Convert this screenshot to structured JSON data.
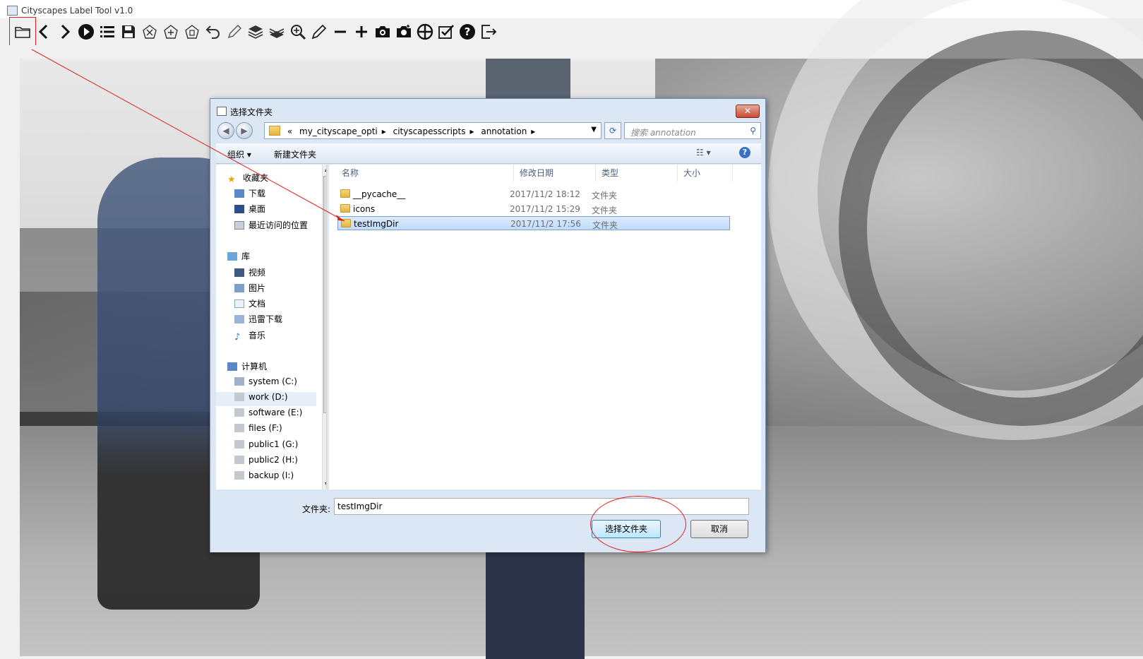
{
  "window": {
    "title": "Cityscapes Label Tool v1.0"
  },
  "toolbar": {
    "icons": [
      "open-folder-icon",
      "previous-icon",
      "next-icon",
      "play-icon",
      "list-icon",
      "save-icon",
      "clear-polygon-icon",
      "new-polygon-icon",
      "delete-polygon-icon",
      "undo-icon",
      "edit-icon",
      "layer-up-icon",
      "layer-down-icon",
      "zoom-icon",
      "pencil-icon",
      "minus-icon",
      "plus-icon",
      "screenshot-icon",
      "screenshot-toggle-icon",
      "crosshair-icon",
      "check-icon",
      "help-icon",
      "exit-icon"
    ]
  },
  "dialog": {
    "title": "选择文件夹",
    "close": "✕",
    "address": {
      "prefix": "«",
      "crumbs": [
        "my_cityscape_opti",
        "cityscapesscripts",
        "annotation"
      ]
    },
    "search_placeholder": "搜索 annotation",
    "commands": {
      "organize": "组织 ▾",
      "new_folder": "新建文件夹"
    },
    "help": "?",
    "nav": {
      "favorites": {
        "label": "收藏夹",
        "items": [
          "下载",
          "桌面",
          "最近访问的位置"
        ]
      },
      "libraries": {
        "label": "库",
        "items": [
          "视频",
          "图片",
          "文档",
          "迅雷下载",
          "音乐"
        ]
      },
      "computer": {
        "label": "计算机",
        "items": [
          "system (C:)",
          "work (D:)",
          "software (E:)",
          "files (F:)",
          "public1 (G:)",
          "public2 (H:)",
          "backup (I:)"
        ]
      }
    },
    "columns": {
      "name": "名称",
      "date": "修改日期",
      "type": "类型",
      "size": "大小"
    },
    "files": [
      {
        "name": "__pycache__",
        "date": "2017/11/2 18:12",
        "type": "文件夹"
      },
      {
        "name": "icons",
        "date": "2017/11/2 15:29",
        "type": "文件夹"
      },
      {
        "name": "testImgDir",
        "date": "2017/11/2 17:56",
        "type": "文件夹"
      }
    ],
    "selected_index": 2,
    "folder_label": "文件夹:",
    "folder_value": "testImgDir",
    "select_button": "选择文件夹",
    "cancel_button": "取消"
  },
  "annotation_color": "#e02020"
}
